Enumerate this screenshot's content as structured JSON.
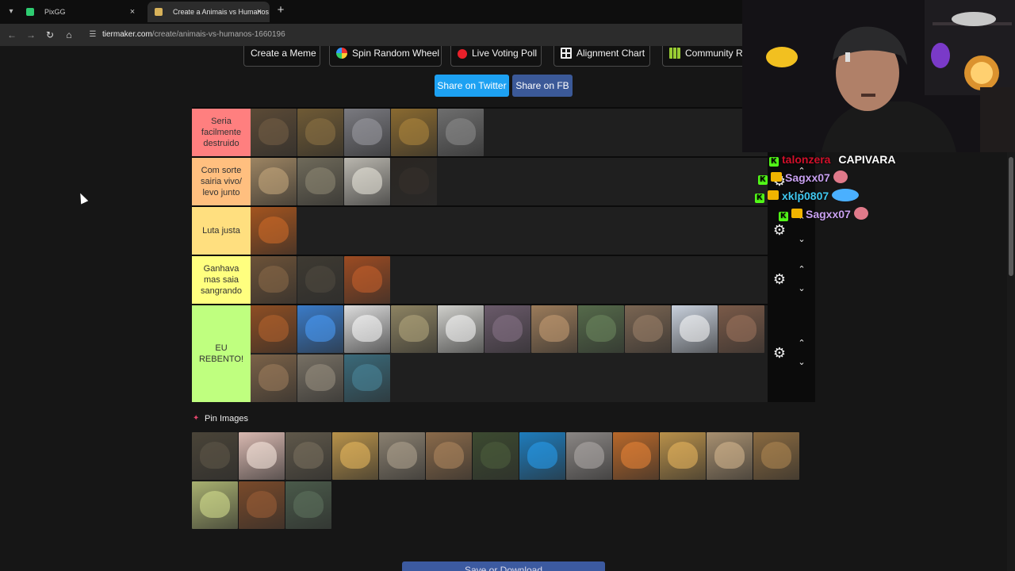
{
  "browser": {
    "tabs": [
      {
        "title": "PixGG",
        "active": false,
        "favicon_color": "#2ecc71"
      },
      {
        "title": "Create a Animais vs Humanos T",
        "active": true,
        "favicon_color": "#d8b25a"
      }
    ],
    "close_glyph": "×",
    "new_tab_glyph": "+",
    "url_host": "tiermaker.com",
    "url_path": "/create/animais-vs-humanos-1660196"
  },
  "toolbar": {
    "items": [
      {
        "label": "Create a Meme",
        "icon": "none"
      },
      {
        "label": "Spin Random Wheel",
        "icon": "wheel-icon"
      },
      {
        "label": "Live Voting Poll",
        "icon": "poll-icon"
      },
      {
        "label": "Alignment Chart",
        "icon": "grid-icon"
      },
      {
        "label": "Community R",
        "icon": "community-grid-icon"
      }
    ]
  },
  "share": {
    "twitter_label": "Share on Twitter",
    "fb_label": "Share on FB",
    "twitter_color": "#1da1f2",
    "fb_color": "#3b5998"
  },
  "tiers": [
    {
      "label": "Seria facilmente destruido",
      "color": "#ff7f7f",
      "tiles": [
        "bear",
        "moose",
        "hippo",
        "jaguar",
        "elephant"
      ]
    },
    {
      "label": "Com sorte sairia vivo/ levo junto",
      "color": "#ffbf7f",
      "tiles": [
        "hyena",
        "crocodile",
        "wolf",
        "chimpanzee"
      ]
    },
    {
      "label": "Luta justa",
      "color": "#ffdf7f",
      "tiles": [
        "orangutan"
      ]
    },
    {
      "label": "Ganhava mas saia sangrando",
      "color": "#ffff7f",
      "tiles": [
        "baboon",
        "eagle",
        "maned-wolf"
      ]
    },
    {
      "label": "EU REBENTO!",
      "color": "#bfff7f",
      "tiles": [
        "monkey",
        "macaw",
        "penguin",
        "ostrich",
        "goose",
        "manatee",
        "deer",
        "hawk",
        "cat",
        "swan",
        "piranha",
        "owl",
        "zebra",
        "peacock"
      ]
    }
  ],
  "tile_colors": {
    "bear": "#5b4a36",
    "moose": "#6f5a35",
    "hippo": "#7a7a80",
    "jaguar": "#8a6a30",
    "elephant": "#6e6e6e",
    "hyena": "#9c8462",
    "crocodile": "#6f6a5a",
    "wolf": "#b9b6ae",
    "chimpanzee": "#2a2622",
    "orangutan": "#a3541f",
    "baboon": "#6c5238",
    "eagle": "#3e3a32",
    "maned-wolf": "#9c4b22",
    "monkey": "#8e4e23",
    "macaw": "#3a7bc8",
    "penguin": "#dcdcdc",
    "ostrich": "#8d8362",
    "goose": "#cfcfcb",
    "manatee": "#6a5a6a",
    "deer": "#9b7b5a",
    "hawk": "#556a4a",
    "cat": "#7a6552",
    "swan": "#c8d0dc",
    "piranha": "#7a5a48",
    "owl": "#7b6248",
    "zebra": "#777064",
    "peacock": "#3a6a7a",
    "boar": "#4a4438",
    "pig": "#d8b8b0",
    "komodo": "#5f584a",
    "cheetah": "#b8924a",
    "ocelot": "#8a8070",
    "capybara": "#8a6a4a",
    "tapir": "#3c4a30",
    "whale": "#1e7cbc",
    "rhino": "#8a8684",
    "tiger": "#b8682a",
    "lion": "#b8904a",
    "giraffe": "#a89070",
    "cobra": "#8a6a40",
    "kangaroo": "#a8b070",
    "horse": "#7a4a2a",
    "panda": "#4a5a4a"
  },
  "pin": {
    "label": "Pin Images",
    "icon": "pushpin-icon"
  },
  "pool_tiles": [
    "boar",
    "pig",
    "komodo",
    "cheetah",
    "ocelot",
    "capybara",
    "tapir",
    "whale",
    "rhino",
    "tiger",
    "lion",
    "giraffe",
    "cobra",
    "kangaroo",
    "horse",
    "panda"
  ],
  "chat": [
    {
      "user": "talonzera",
      "user_color": "#d0102a",
      "message": "CAPIVARA",
      "badges": [
        "kick-badge"
      ]
    },
    {
      "user": "Sagxx07",
      "user_color": "#c8a0f0",
      "message": "",
      "badges": [
        "kick-badge",
        "crown-badge"
      ],
      "emote_color": "#e07a8a"
    },
    {
      "user": "xklp0807",
      "user_color": "#40c8f0",
      "message": "",
      "badges": [
        "kick-badge",
        "crown-badge"
      ],
      "emote_color": "#4ab0ff"
    },
    {
      "user": "Sagxx07",
      "user_color": "#c8a0f0",
      "message": "",
      "badges": [
        "kick-badge",
        "crown-badge"
      ],
      "emote_color": "#e07a8a"
    }
  ],
  "bottom_button": {
    "label": "Save or Download"
  },
  "icons": {
    "gear": "⚙",
    "up": "⌃",
    "down": "⌄",
    "back": "←",
    "forward": "→",
    "reload": "↻",
    "home": "⌂",
    "pin": "📌"
  }
}
